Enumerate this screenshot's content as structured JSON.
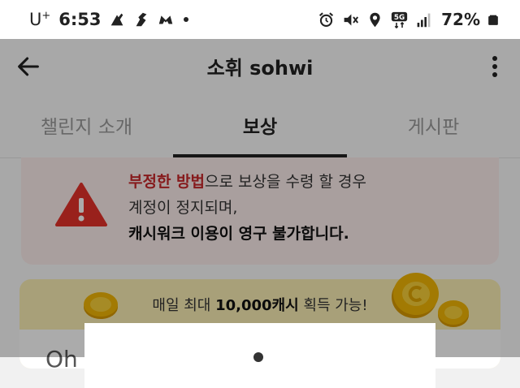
{
  "status_bar": {
    "carrier": "U",
    "carrier_plus": "+",
    "time": "6:53",
    "battery": "72%",
    "network": "5G",
    "colors": {
      "background": "#ffffff",
      "text": "#222222"
    },
    "left_icons": [
      "notification-app-icon",
      "notification-app-icon-2",
      "notification-app-icon-3",
      "dot-icon"
    ],
    "right_icons": [
      "alarm-icon",
      "vibrate-icon",
      "location-icon",
      "5g-icon",
      "signal-icon",
      "battery-icon"
    ]
  },
  "app_bar": {
    "title": "소휘 sohwi",
    "icons": [
      "back-arrow-icon",
      "more-vertical-icon"
    ]
  },
  "tabs": [
    {
      "label": "챌린지 소개",
      "active": false
    },
    {
      "label": "보상",
      "active": true
    },
    {
      "label": "게시판",
      "active": false
    }
  ],
  "warning": {
    "line1_red": "부정한 방법",
    "line1_rest": "으로 보상을 수령 할 경우",
    "line2": "계정이 정지되며,",
    "line3": "캐시워크 이용이 영구 불가합니다.",
    "icon": "warning-triangle-icon",
    "colors": {
      "background": "#fdeeec",
      "icon": "#e5322b",
      "highlight": "#c8282b"
    }
  },
  "reward_banner": {
    "prefix": "매일 최대 ",
    "amount": "10,000캐시",
    "suffix": " 획득 가능!",
    "partial_text": "Oh",
    "colors": {
      "background": "#fbefb5",
      "coin": "#f2b705"
    }
  },
  "overlay": {
    "color": "rgba(0,0,0,0.33)"
  }
}
